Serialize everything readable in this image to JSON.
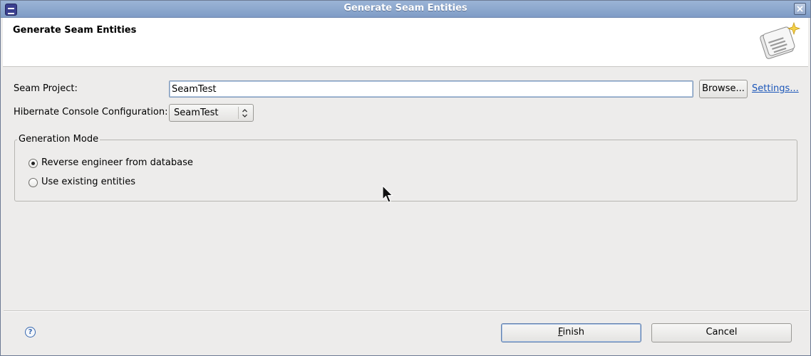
{
  "window": {
    "title": "Generate Seam Entities",
    "accent": "#8aa5cc"
  },
  "header": {
    "title": "Generate Seam Entities",
    "icon": "seam-wizard-banner-icon"
  },
  "form": {
    "seam_project_label": "Seam Project:",
    "seam_project_value": "SeamTest",
    "browse_label": "Browse...",
    "settings_label": "Settings...",
    "hibernate_label": "Hibernate Console Configuration:",
    "hibernate_value": "SeamTest"
  },
  "generation_mode": {
    "label": "Generation Mode",
    "options": [
      {
        "label": "Reverse engineer from database",
        "selected": true
      },
      {
        "label": "Use existing entities",
        "selected": false
      }
    ]
  },
  "footer": {
    "help_icon": "help-icon",
    "finish_label": "Finish",
    "finish_mnemonic": "F",
    "cancel_label": "Cancel"
  }
}
